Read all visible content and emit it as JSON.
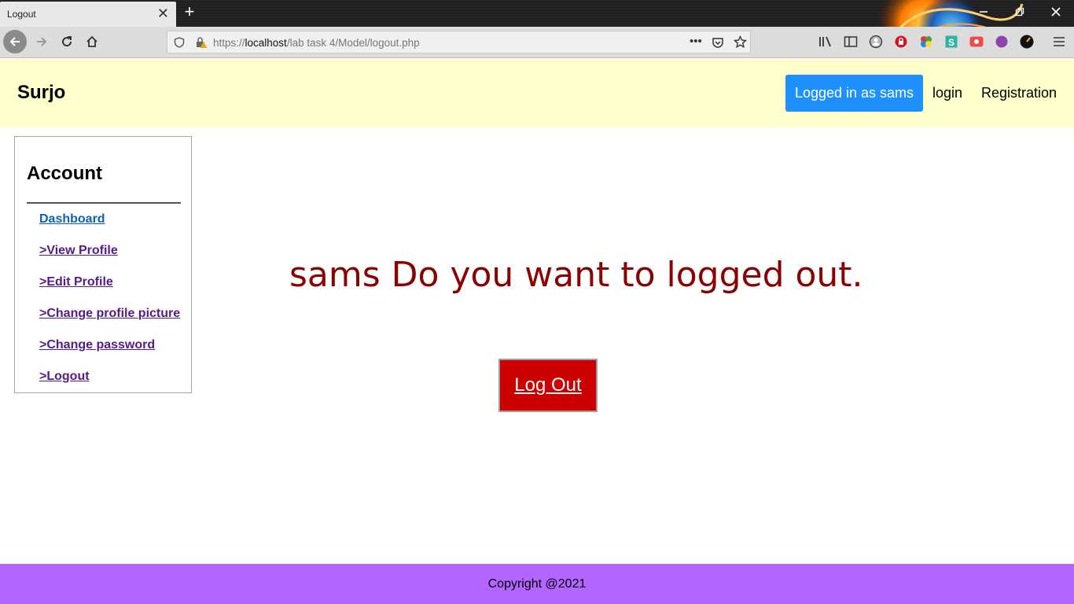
{
  "browser": {
    "tab_title": "Logout",
    "tab_close": "✕",
    "new_tab": "+",
    "url_prefix": "https://",
    "url_host": "localhost",
    "url_path": "/lab task 4/Model/logout.php",
    "url_more": "•••"
  },
  "header": {
    "brand": "Surjo",
    "logged_in_label": "Logged in as sams",
    "login_label": "login",
    "registration_label": "Registration"
  },
  "sidebar": {
    "title": "Account",
    "links": [
      {
        "label": "Dashboard"
      },
      {
        "label": ">View Profile"
      },
      {
        "label": ">Edit Profile"
      },
      {
        "label": ">Change profile picture"
      },
      {
        "label": ">Change password"
      },
      {
        "label": ">Logout"
      }
    ]
  },
  "main": {
    "message": "sams Do you want to logged out.",
    "logout_button": "Log Out"
  },
  "footer": {
    "copyright": "Copyright @2021"
  },
  "colors": {
    "header_bg": "#ffffcc",
    "logged_in_bg": "#1e90ff",
    "message_color": "#8b0000",
    "logout_bg": "#cc0000",
    "footer_bg": "#b366ff"
  }
}
